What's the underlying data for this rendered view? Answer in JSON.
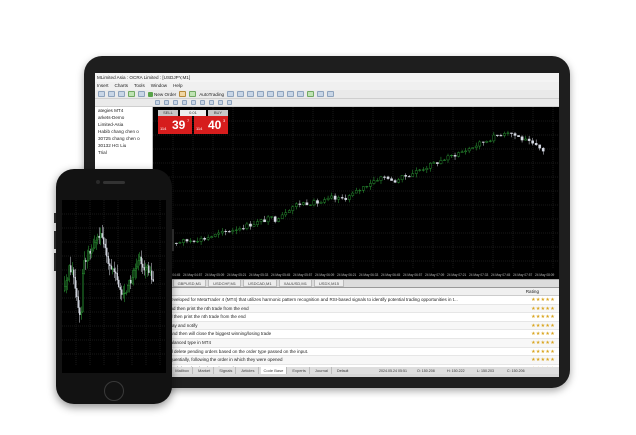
{
  "window": {
    "title": "MLimited Asia : OCRA Limited : [USDJPY,M1]"
  },
  "menu": [
    "Insert",
    "Charts",
    "Tools",
    "Window",
    "Help"
  ],
  "toolbar": {
    "new_order": "New Order",
    "auto_trading": "AutoTrading"
  },
  "navigator": {
    "items": [
      "ategies MT4",
      "",
      "arkets-Demo",
      "Limited-Asia",
      "Habib chang chen o",
      "30725 chang chen o",
      "30132 HG Liu",
      "Trial"
    ]
  },
  "one_click": {
    "sell_label": "SELL",
    "buy_label": "BUY",
    "lot": "0.01",
    "sell_prefix": "114",
    "sell_big": "39",
    "sell_sup": "7",
    "buy_prefix": "114",
    "buy_big": "40",
    "buy_sup": "3",
    "sell_color": "#d61d1d",
    "buy_color": "#d61d1d"
  },
  "time_labels": [
    "24 May 04:45",
    "24 May 04:57",
    "24 May 05:09",
    "24 May 05:21",
    "24 May 05:33",
    "24 May 05:45",
    "24 May 05:57",
    "24 May 06:09",
    "24 May 06:21",
    "24 May 06:33",
    "24 May 06:45",
    "24 May 06:57",
    "24 May 07:09",
    "24 May 07:21",
    "24 May 07:33",
    "24 May 07:45",
    "24 May 07:57",
    "24 May 08:09"
  ],
  "chart_tabs": [
    "M1",
    "GBPUSD,M1",
    "USDCHF,M1",
    "USDCAD,M1",
    "XAUUSD,M1",
    "USDX,M15"
  ],
  "terminal": {
    "header": {
      "name": "Description",
      "rating": "Rating"
    },
    "rows": [
      "mmonBA is an Expert Advisor (EA) developed for MetaTrader 4 (MT4) that utilizes harmonic pattern recognition and RSI-based signals to identify potential trading opportunities in t...",
      "s EA will scan all the closed trades and then print the nth trade from the end",
      "s EA will scan all the open trades and then print the nth trade from the end",
      "s script will detect an end of trading day and notify",
      "s script will scan all the open trades and then will close the biggest winning/losing trade",
      "s script will close hedge trade of unbalanced type in MT4",
      "s script will close all active trades and delete pending orders based on the order type passed on the input.",
      "s script will close all active trades sequentially, following the order in which they were opened",
      "s script will calculate the total  active and closed orders based on order types"
    ],
    "stars": "★★★★★"
  },
  "terminal_tabs": [
    "Alerts",
    "Mailbox",
    "Market",
    "Signals",
    "Articles",
    "Code Base",
    "Experts",
    "Journal"
  ],
  "status": {
    "profile": "Default",
    "datetime": "2024.05.24 05:51",
    "o": "O: 150.208",
    "h": "H: 150.222",
    "l": "L: 150.203",
    "c": "C: 150.206"
  },
  "accent": {
    "bull": "#2fa83a",
    "bear": "#d8dce6",
    "grid": "#3a3a3a"
  }
}
